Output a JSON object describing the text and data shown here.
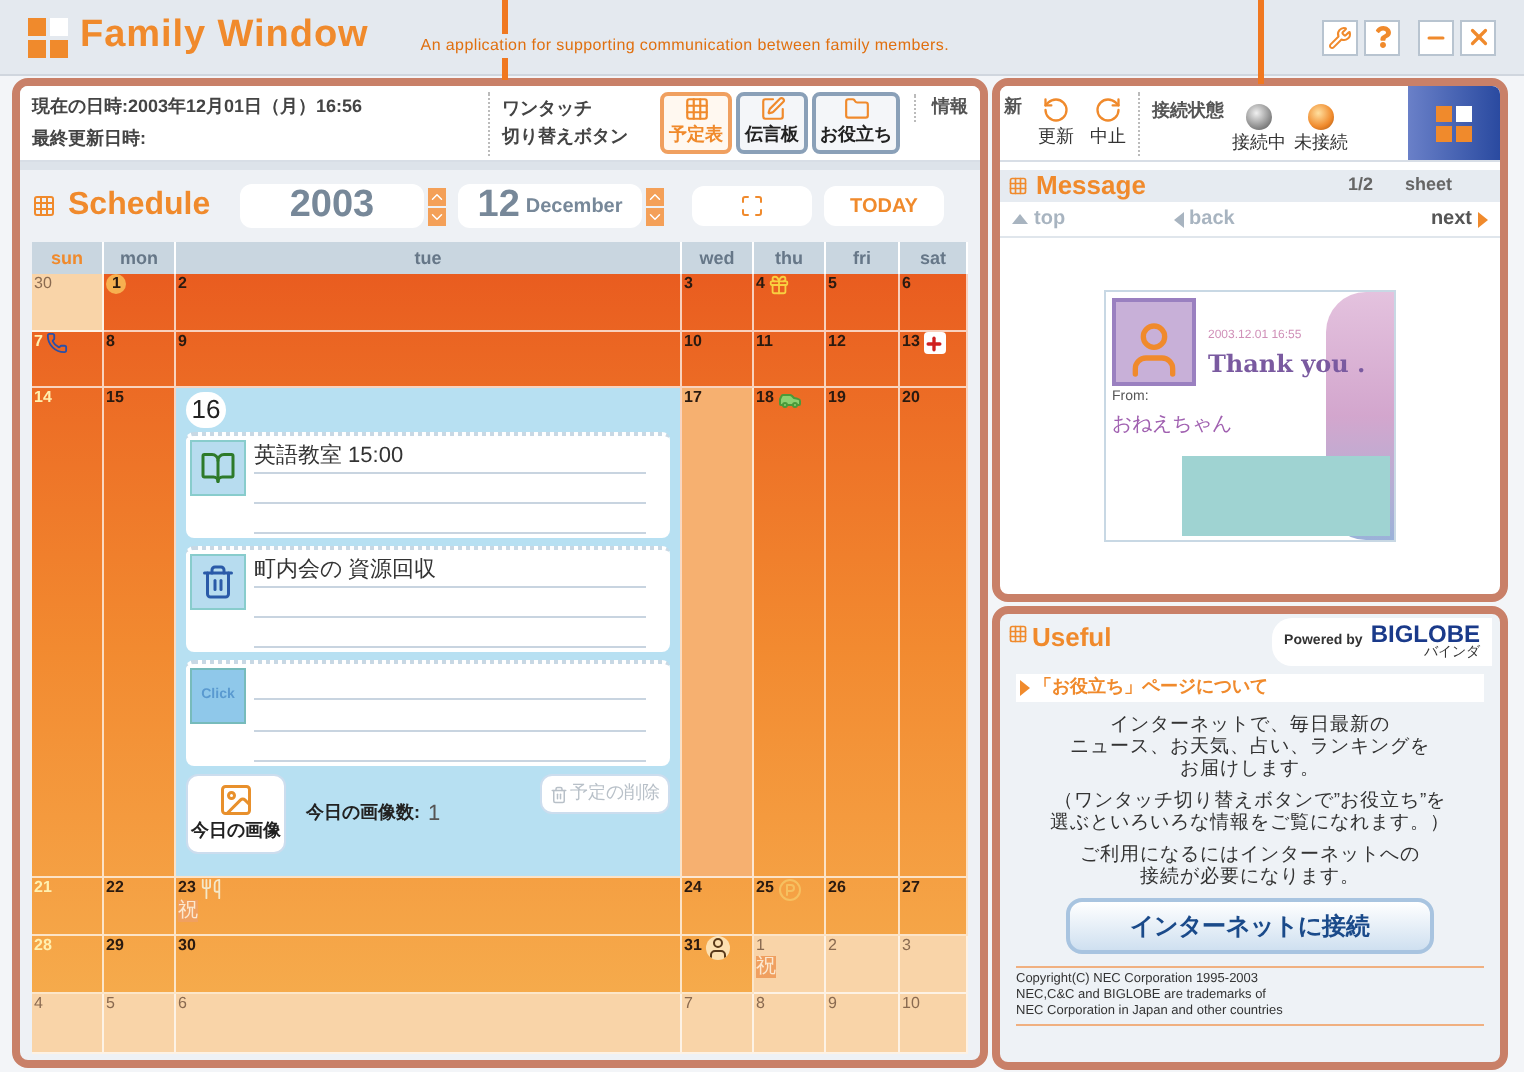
{
  "window": {
    "title": "Family Window",
    "subtitle": "An application for supporting communication between family members."
  },
  "info_bar": {
    "current_datetime": "現在の日時:2003年12月01日（月）16:56",
    "last_updated": "最終更新日時:",
    "switch_label": [
      "ワンタッチ",
      "切り替えボタン"
    ],
    "view_buttons": [
      {
        "label": "予定表",
        "selected": true,
        "kind": "grid"
      },
      {
        "label": "伝言板",
        "selected": false,
        "kind": "note"
      },
      {
        "label": "お役立ち",
        "selected": false,
        "kind": "folder"
      }
    ],
    "info_label": "情報"
  },
  "toolbar": {
    "update_label_tail": "新",
    "buttons": [
      {
        "label": "更新",
        "kind": "refresh"
      },
      {
        "label": "中止",
        "kind": "stop"
      }
    ],
    "status_label": "接続状態",
    "status_lamps": [
      {
        "label": "接続中",
        "on": false
      },
      {
        "label": "未接続",
        "on": true
      }
    ]
  },
  "schedule": {
    "title": "Schedule",
    "year": "2003",
    "month": "12",
    "month_name": "December",
    "today_button": "TODAY",
    "weekdays": [
      "sun",
      "mon",
      "tue",
      "wed",
      "thu",
      "fri",
      "sat"
    ],
    "weeks": [
      {
        "days": [
          {
            "day": "30",
            "other_month": true,
            "kind": "plain"
          },
          {
            "day": "1",
            "other_month": false,
            "kind": "today"
          },
          {
            "day": "2",
            "other_month": false,
            "kind": "plain"
          },
          {
            "day": "3",
            "other_month": false,
            "kind": "plain"
          },
          {
            "day": "4",
            "other_month": false,
            "kind": "gift"
          },
          {
            "day": "5",
            "other_month": false,
            "kind": "plain"
          },
          {
            "day": "6",
            "other_month": false,
            "kind": "plain"
          }
        ]
      },
      {
        "days": [
          {
            "day": "7",
            "other_month": false,
            "kind": "phone"
          },
          {
            "day": "8",
            "other_month": false,
            "kind": "plain"
          },
          {
            "day": "9",
            "other_month": false,
            "kind": "plain"
          },
          {
            "day": "10",
            "other_month": false,
            "kind": "plain"
          },
          {
            "day": "11",
            "other_month": false,
            "kind": "plain"
          },
          {
            "day": "12",
            "other_month": false,
            "kind": "plain"
          },
          {
            "day": "13",
            "other_month": false,
            "kind": "medical"
          }
        ]
      },
      {
        "days": [
          {
            "day": "14",
            "other_month": false,
            "kind": "plain"
          },
          {
            "day": "15",
            "other_month": false,
            "kind": "plain"
          },
          {
            "day": "16",
            "other_month": false,
            "kind": "expanded"
          },
          {
            "day": "17",
            "other_month": false,
            "kind": "plain"
          },
          {
            "day": "18",
            "other_month": false,
            "kind": "car"
          },
          {
            "day": "19",
            "other_month": false,
            "kind": "plain"
          },
          {
            "day": "20",
            "other_month": false,
            "kind": "plain"
          }
        ]
      },
      {
        "days": [
          {
            "day": "21",
            "other_month": false,
            "kind": "plain"
          },
          {
            "day": "22",
            "other_month": false,
            "kind": "plain"
          },
          {
            "day": "23",
            "other_month": false,
            "kind": "meal",
            "badge": "祝"
          },
          {
            "day": "24",
            "other_month": false,
            "kind": "plain"
          },
          {
            "day": "25",
            "other_month": false,
            "kind": "parking"
          },
          {
            "day": "26",
            "other_month": false,
            "kind": "plain"
          },
          {
            "day": "27",
            "other_month": false,
            "kind": "plain"
          }
        ]
      },
      {
        "days": [
          {
            "day": "28",
            "other_month": false,
            "kind": "plain"
          },
          {
            "day": "29",
            "other_month": false,
            "kind": "plain"
          },
          {
            "day": "30",
            "other_month": false,
            "kind": "plain"
          },
          {
            "day": "31",
            "other_month": false,
            "kind": "person"
          },
          {
            "day": "1",
            "other_month": true,
            "kind": "plain",
            "badge": "祝"
          },
          {
            "day": "2",
            "other_month": true,
            "kind": "plain"
          },
          {
            "day": "3",
            "other_month": true,
            "kind": "plain"
          }
        ]
      },
      {
        "days": [
          {
            "day": "4",
            "other_month": true,
            "kind": "plain"
          },
          {
            "day": "5",
            "other_month": true,
            "kind": "plain"
          },
          {
            "day": "6",
            "other_month": true,
            "kind": "plain"
          },
          {
            "day": "7",
            "other_month": true,
            "kind": "plain"
          },
          {
            "day": "8",
            "other_month": true,
            "kind": "plain"
          },
          {
            "day": "9",
            "other_month": true,
            "kind": "plain"
          },
          {
            "day": "10",
            "other_month": true,
            "kind": "plain"
          }
        ]
      }
    ],
    "day_panel": {
      "entries": [
        {
          "kind": "study",
          "text": "英語教室 15:00"
        },
        {
          "kind": "garbage",
          "text": "町内会の 資源回収"
        },
        {
          "kind": "click",
          "button": "Click"
        }
      ],
      "image_button": "今日の画像",
      "image_count_label": "今日の画像数:",
      "image_count": "1",
      "delete_button": {
        "label": "予定の削除",
        "disabled": true
      }
    }
  },
  "message": {
    "title": "Message",
    "page": "1/2",
    "unit": "sheet",
    "nav": [
      {
        "label": "top",
        "kind": "up",
        "disabled": true
      },
      {
        "label": "back",
        "kind": "left",
        "disabled": true
      },
      {
        "label": "next",
        "kind": "right",
        "disabled": false
      }
    ],
    "card": {
      "date": "2003.12.01  16:55",
      "text": "Thank you .",
      "from_label": "From:",
      "from": "おねえちゃん"
    }
  },
  "useful": {
    "title": "Useful",
    "powered_by": "Powered by",
    "brand": "BIGLOBE",
    "brand_sub": "バインダ",
    "heading": "「お役立ち」ページについて",
    "paragraphs": [
      [
        "インターネットで、毎日最新の",
        "ニュース、お天気、占い、ランキングを",
        "お届けします。"
      ],
      [
        "（ワンタッチ切り替えボタンで”お役立ち”を",
        "選ぶといろいろな情報をご覧になれます。）"
      ],
      [
        "ご利用になるにはインターネットへの",
        "接続が必要になります。"
      ]
    ],
    "connect_button": "インターネットに接続",
    "copyright": [
      "Copyright(C) NEC Corporation 1995-2003",
      "NEC,C&C and BIGLOBE are trademarks of",
      "NEC Corporation in Japan and other countries"
    ]
  }
}
